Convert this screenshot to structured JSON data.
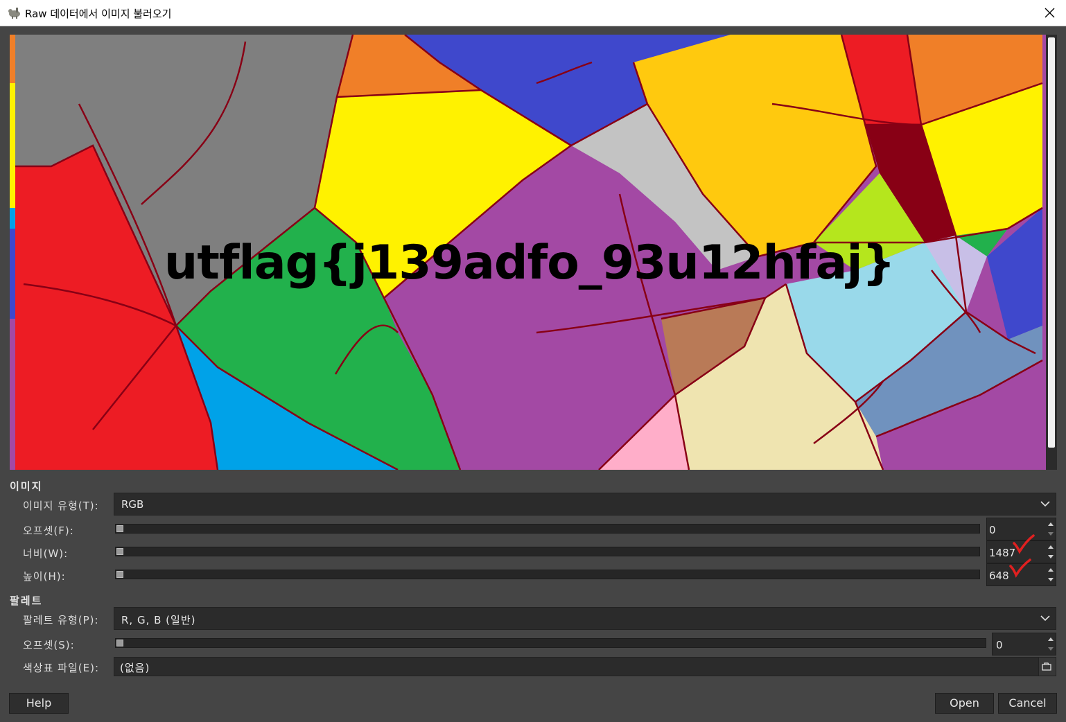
{
  "window": {
    "title": "Raw 데이터에서 이미지 불러오기"
  },
  "preview": {
    "overlay_text": "utflag{j139adfo_93u12hfaj}"
  },
  "image_section": {
    "label": "이미지",
    "image_type": {
      "label": "이미지 유형(T):",
      "value": "RGB"
    },
    "offset": {
      "label": "오프셋(F):",
      "value": "0"
    },
    "width": {
      "label": "너비(W):",
      "value": "1487"
    },
    "height": {
      "label": "높이(H):",
      "value": "648"
    }
  },
  "palette_section": {
    "label": "팔레트",
    "palette_type": {
      "label": "팔레트 유형(P):",
      "value": "R, G, B (일반)"
    },
    "offset": {
      "label": "오프셋(S):",
      "value": "0"
    },
    "colormap_file": {
      "label": "색상표 파일(E):",
      "value": "(없음)"
    }
  },
  "buttons": {
    "help": "Help",
    "open": "Open",
    "cancel": "Cancel"
  },
  "colors": {
    "background": "#454545",
    "field": "#2b2b2b",
    "annotation": "#e02020"
  }
}
